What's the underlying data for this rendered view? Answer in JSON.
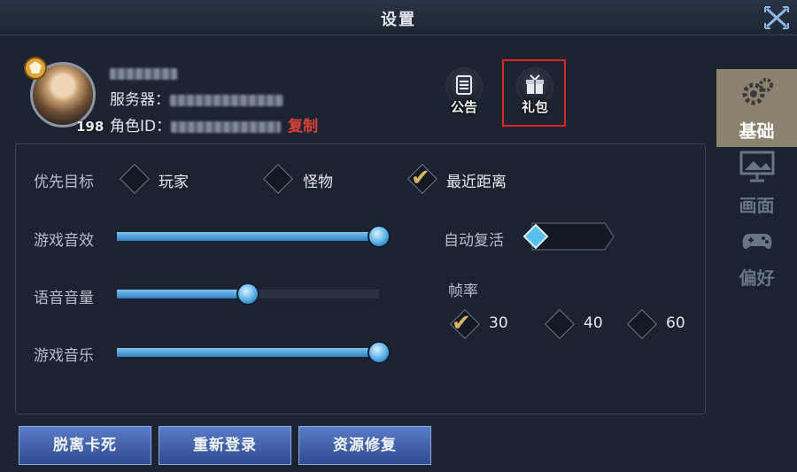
{
  "window": {
    "title": "设置"
  },
  "profile": {
    "level": "198",
    "server_label": "服务器：",
    "role_id_label": "角色ID：",
    "copy_label": "复制"
  },
  "top_buttons": {
    "notice_label": "公告",
    "gift_label": "礼包"
  },
  "settings": {
    "priority": {
      "label": "优先目标",
      "options": [
        "玩家",
        "怪物",
        "最近距离"
      ],
      "selected": "最近距离"
    },
    "volumes": [
      {
        "label": "游戏音效",
        "value": 1.0
      },
      {
        "label": "语音音量",
        "value": 0.5
      },
      {
        "label": "游戏音乐",
        "value": 1.0
      }
    ],
    "auto_revive": {
      "label": "自动复活",
      "on": false
    },
    "fps": {
      "label": "帧率",
      "options": [
        "30",
        "40",
        "60"
      ],
      "selected": "30"
    }
  },
  "tabs": [
    {
      "label": "基础",
      "icon": "gears-icon",
      "active": true
    },
    {
      "label": "画面",
      "icon": "monitor-icon",
      "active": false
    },
    {
      "label": "偏好",
      "icon": "gamepad-icon",
      "active": false
    }
  ],
  "bottom_buttons": {
    "unstuck": "脱离卡死",
    "relogin": "重新登录",
    "repair": "资源修复"
  },
  "colors": {
    "accent_blue": "#4a9ad8",
    "check_gold": "#d8b45a",
    "copy_red": "#e0413a",
    "active_tab": "#8c8270"
  }
}
